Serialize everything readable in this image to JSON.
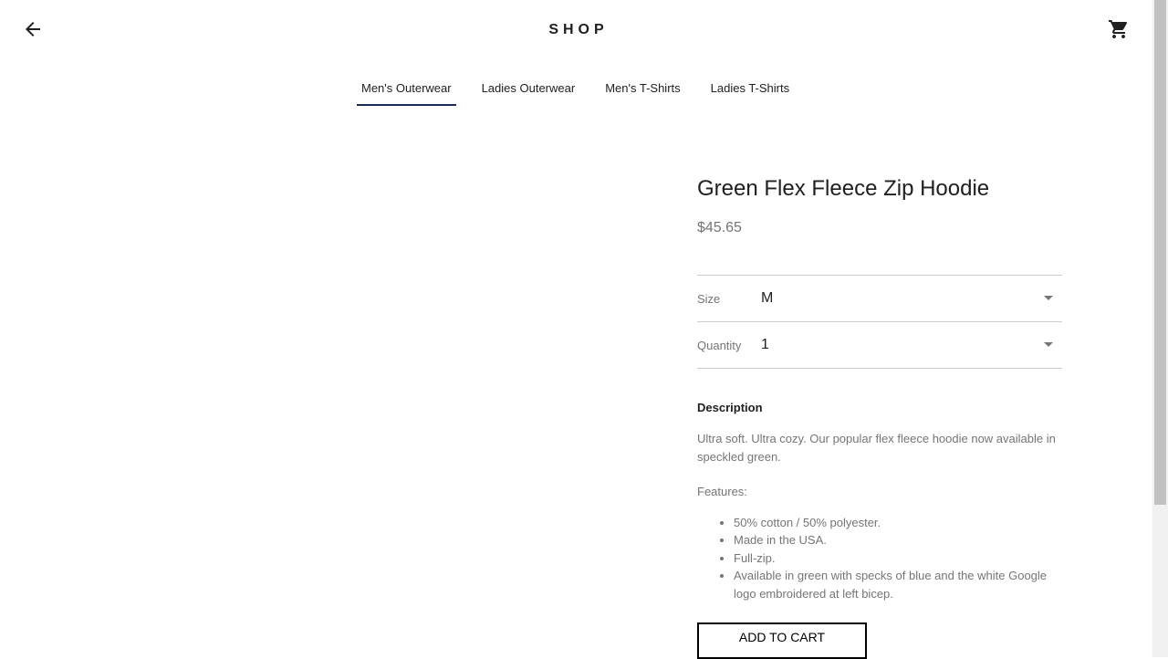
{
  "header": {
    "title": "SHOP",
    "back_icon": "arrow-back-icon",
    "cart_icon": "shopping-cart-icon"
  },
  "tabs": [
    {
      "label": "Men's Outerwear",
      "active": true
    },
    {
      "label": "Ladies Outerwear"
    },
    {
      "label": "Men's T-Shirts"
    },
    {
      "label": "Ladies T-Shirts"
    }
  ],
  "product": {
    "title": "Green Flex Fleece Zip Hoodie",
    "price": "$45.65",
    "size_label": "Size",
    "size_value": "M",
    "quantity_label": "Quantity",
    "quantity_value": "1",
    "description_heading": "Description",
    "description": "Ultra soft. Ultra cozy. Our popular flex fleece hoodie now available in speckled green.",
    "features_label": "Features:",
    "features": [
      "50% cotton / 50% polyester.",
      "Made in the USA.",
      "Full-zip.",
      "Available in green with specks of blue and the white Google logo embroidered at left bicep."
    ],
    "add_to_cart": "ADD TO CART"
  },
  "colors": {
    "accent": "#172c50"
  }
}
